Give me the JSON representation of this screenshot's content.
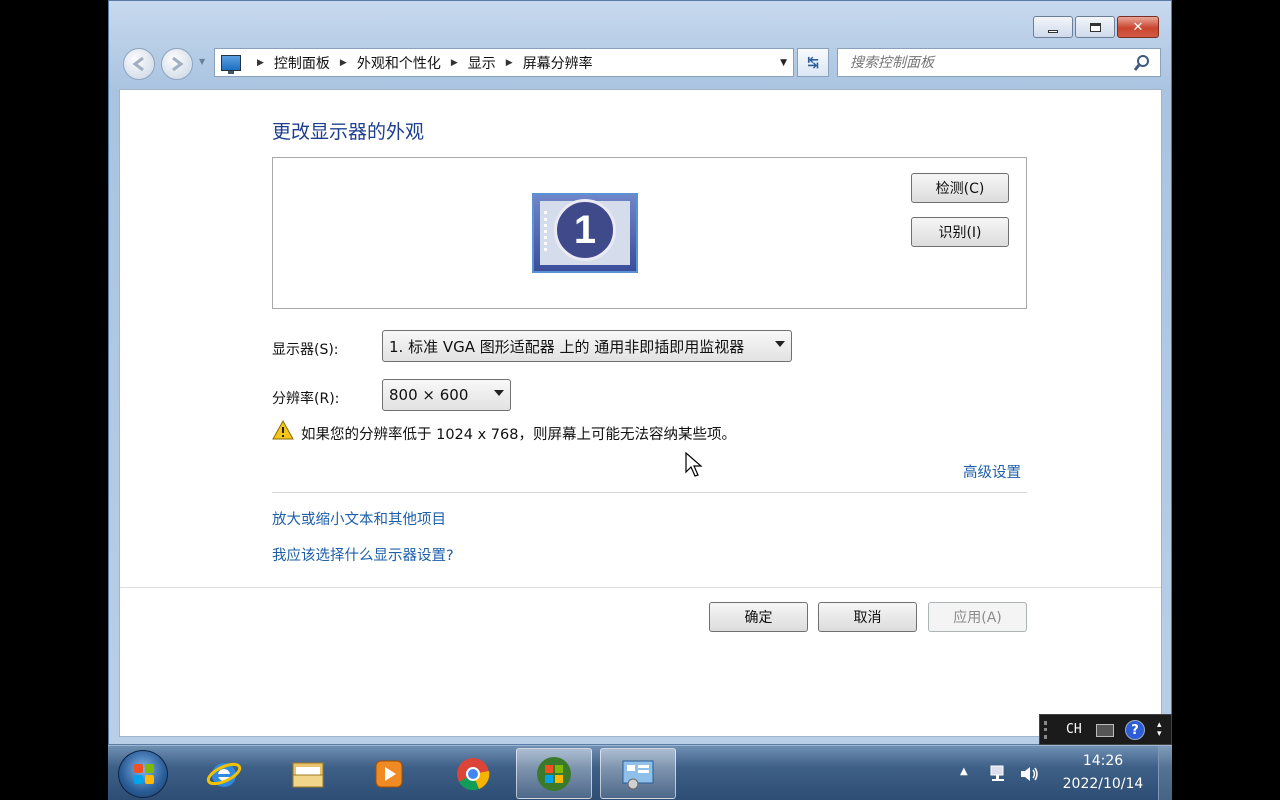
{
  "window": {
    "breadcrumbs": [
      "控制面板",
      "外观和个性化",
      "显示",
      "屏幕分辨率"
    ],
    "search_placeholder": "搜索控制面板"
  },
  "content": {
    "page_title": "更改显示器的外观",
    "preview": {
      "monitor_number": "1",
      "detect_label": "检测(C)",
      "identify_label": "识别(I)"
    },
    "display_label": "显示器(S):",
    "display_value": "1. 标准 VGA 图形适配器 上的 通用非即插即用监视器",
    "resolution_label": "分辨率(R):",
    "resolution_value": "800 × 600",
    "warning_text": "如果您的分辨率低于 1024 x 768，则屏幕上可能无法容纳某些项。",
    "advanced_link": "高级设置",
    "text_size_link": "放大或缩小文本和其他项目",
    "which_settings_link": "我应该选择什么显示器设置?",
    "ok_label": "确定",
    "cancel_label": "取消",
    "apply_label": "应用(A)"
  },
  "taskbar": {
    "items": [
      "internet-explorer-icon",
      "windows-explorer-icon",
      "media-player-icon",
      "chrome-icon",
      "windows-logo-icon",
      "control-panel-icon"
    ],
    "clock_time": "14:26",
    "clock_date": "2022/10/14"
  },
  "language_bar": {
    "language": "CH",
    "help": "?"
  },
  "colors": {
    "link": "#1e5fa8",
    "title": "#1e3f8f",
    "taskbar": "#3e5f86"
  }
}
